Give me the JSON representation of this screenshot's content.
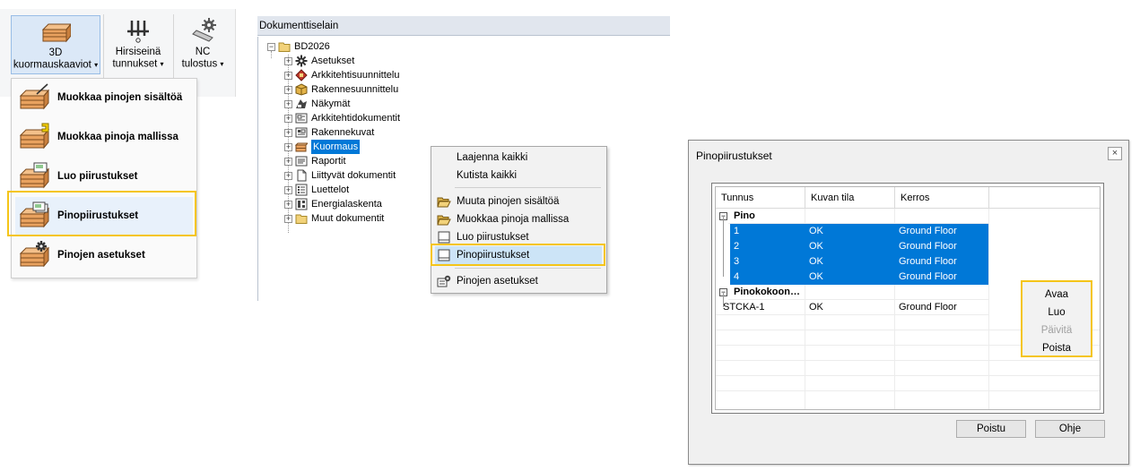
{
  "ribbon": {
    "buttons": [
      {
        "line1": "3D",
        "line2": "kuormauskaaviot",
        "caret": "▾",
        "icon": "stack-3d-icon"
      },
      {
        "line1": "Hirsiseinä",
        "line2": "tunnukset",
        "caret": "▾",
        "icon": "log-wall-icon"
      },
      {
        "line1": "NC",
        "line2": "tulostus",
        "caret": "▾",
        "icon": "nc-gear-icon"
      }
    ]
  },
  "dropdown": {
    "items": [
      {
        "label": "Muokkaa pinojen sisältöä",
        "icon": "stack-edit-icon"
      },
      {
        "label": "Muokkaa pinoja mallissa",
        "icon": "stack-model-icon"
      },
      {
        "label": "Luo piirustukset",
        "icon": "stack-drawing-icon"
      },
      {
        "label": "Pinopiirustukset",
        "icon": "stack-drawings-icon"
      },
      {
        "label": "Pinojen asetukset",
        "icon": "stack-settings-icon"
      }
    ],
    "highlighted": "Pinopiirustukset"
  },
  "document_browser": {
    "title": "Dokumenttiselain",
    "root": "BD2026",
    "items": [
      {
        "label": "Asetukset",
        "icon": "gear-icon"
      },
      {
        "label": "Arkkitehtisuunnittelu",
        "icon": "architecture-icon"
      },
      {
        "label": "Rakennesuunnittelu",
        "icon": "structure-icon"
      },
      {
        "label": "Näkymät",
        "icon": "views-icon"
      },
      {
        "label": "Arkkitehtidokumentit",
        "icon": "architect-docs-icon"
      },
      {
        "label": "Rakennekuvat",
        "icon": "structure-drawings-icon"
      },
      {
        "label": "Kuormaus",
        "icon": "loading-icon",
        "selected": true
      },
      {
        "label": "Raportit",
        "icon": "reports-icon"
      },
      {
        "label": "Liittyvät dokumentit",
        "icon": "document-icon"
      },
      {
        "label": "Luettelot",
        "icon": "lists-icon"
      },
      {
        "label": "Energialaskenta",
        "icon": "energy-icon"
      },
      {
        "label": "Muut dokumentit",
        "icon": "folder-icon"
      }
    ]
  },
  "context_menu": {
    "items": [
      {
        "label": "Laajenna kaikki"
      },
      {
        "label": "Kutista kaikki"
      },
      {
        "label": "Muuta pinojen sisältöä",
        "icon": "open-folder-icon"
      },
      {
        "label": "Muokkaa pinoja mallissa",
        "icon": "open-folder-icon"
      },
      {
        "label": "Luo piirustukset",
        "icon": "drawing-icon"
      },
      {
        "label": "Pinopiirustukset",
        "icon": "drawing-icon"
      },
      {
        "label": "Pinojen asetukset",
        "icon": "settings-icon"
      }
    ],
    "highlighted": "Pinopiirustukset"
  },
  "dialog": {
    "title": "Pinopiirustukset",
    "close": "×",
    "columns": [
      "Tunnus",
      "Kuvan tila",
      "Kerros"
    ],
    "sort_indicator": "^",
    "groups": [
      {
        "name": "Pino",
        "rows": [
          {
            "id": "1",
            "status": "OK",
            "floor": "Ground Floor",
            "selected": true
          },
          {
            "id": "2",
            "status": "OK",
            "floor": "Ground Floor",
            "selected": true
          },
          {
            "id": "3",
            "status": "OK",
            "floor": "Ground Floor",
            "selected": true
          },
          {
            "id": "4",
            "status": "OK",
            "floor": "Ground Floor",
            "selected": true
          }
        ]
      },
      {
        "name": "Pinokokoon…",
        "rows": [
          {
            "id": "STCKA-1",
            "status": "OK",
            "floor": "Ground Floor",
            "selected": false
          }
        ]
      }
    ],
    "popup_menu": [
      {
        "label": "Avaa",
        "enabled": true
      },
      {
        "label": "Luo",
        "enabled": true
      },
      {
        "label": "Päivitä",
        "enabled": false
      },
      {
        "label": "Poista",
        "enabled": true
      }
    ],
    "buttons": {
      "close": "Poistu",
      "help": "Ohje"
    }
  },
  "colors": {
    "highlight_border": "#f5c518",
    "selection": "#0078d7",
    "menu_hover": "#cce4f7"
  }
}
